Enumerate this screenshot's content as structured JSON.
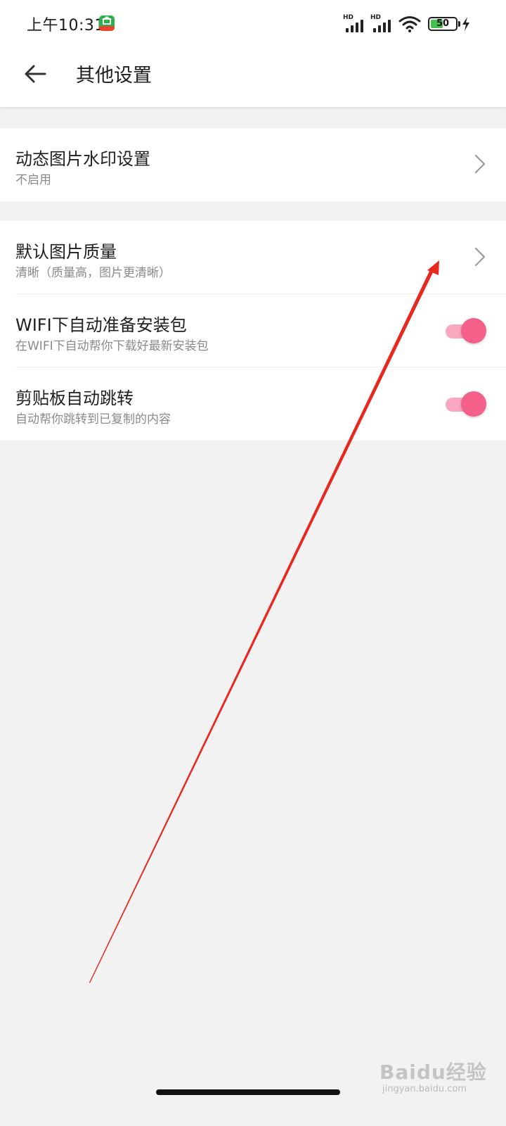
{
  "status_bar": {
    "time": "上午10:31",
    "network_label_1": "HD",
    "network_label_2": "HD",
    "battery_percent": "50",
    "battery_level": 0.5
  },
  "header": {
    "title": "其他设置"
  },
  "settings": [
    {
      "title": "动态图片水印设置",
      "subtitle": "不启用",
      "control": "chevron"
    },
    {
      "title": "默认图片质量",
      "subtitle": "清晰（质量高，图片更清晰）",
      "control": "chevron"
    },
    {
      "title": "WIFI下自动准备安装包",
      "subtitle": "在WIFI下自动帮你下载好最新安装包",
      "control": "toggle",
      "enabled": true
    },
    {
      "title": "剪贴板自动跳转",
      "subtitle": "自动帮你跳转到已复制的内容",
      "control": "toggle",
      "enabled": true
    }
  ],
  "colors": {
    "accent": "#f5608a",
    "annotation": "#e8281f",
    "background": "#f2f2f2"
  },
  "watermark": {
    "brand": "Baidu经验",
    "url": "jingyan.baidu.com"
  }
}
